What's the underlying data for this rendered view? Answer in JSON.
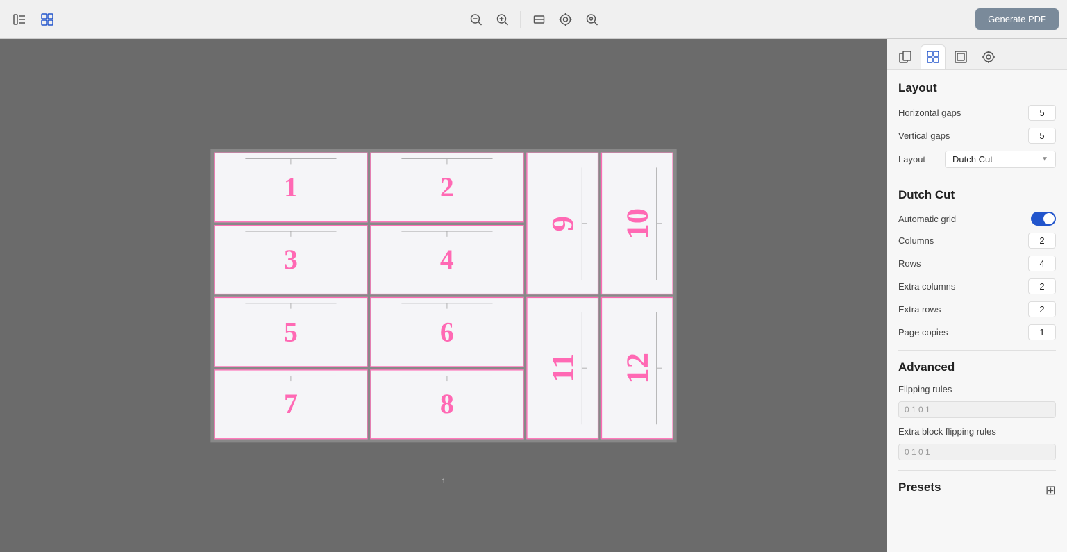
{
  "toolbar": {
    "zoom_out_label": "zoom-out",
    "zoom_in_label": "zoom-in",
    "fit_label": "fit",
    "zoom_reset_label": "zoom-reset",
    "zoom_full_label": "zoom-full",
    "generate_pdf": "Generate PDF"
  },
  "panel_tabs": [
    {
      "id": "copies",
      "icon": "⊞",
      "label": "Copies"
    },
    {
      "id": "layout",
      "icon": "▦",
      "label": "Layout",
      "active": true
    },
    {
      "id": "marks",
      "icon": "⊡",
      "label": "Marks"
    },
    {
      "id": "target",
      "icon": "◎",
      "label": "Target"
    }
  ],
  "layout_section": {
    "title": "Layout",
    "horizontal_gaps_label": "Horizontal gaps",
    "horizontal_gaps_value": "5",
    "vertical_gaps_label": "Vertical gaps",
    "vertical_gaps_value": "5",
    "layout_label": "Layout",
    "layout_value": "Dutch Cut"
  },
  "dutch_cut_section": {
    "title": "Dutch Cut",
    "automatic_grid_label": "Automatic grid",
    "columns_label": "Columns",
    "columns_value": "2",
    "rows_label": "Rows",
    "rows_value": "4",
    "extra_columns_label": "Extra columns",
    "extra_columns_value": "2",
    "extra_rows_label": "Extra rows",
    "extra_rows_value": "2",
    "page_copies_label": "Page copies",
    "page_copies_value": "1"
  },
  "advanced_section": {
    "title": "Advanced",
    "flipping_rules_label": "Flipping rules",
    "flipping_rules_value": "0 1 0 1",
    "extra_block_label": "Extra block flipping rules",
    "extra_block_value": "0 1 0 1"
  },
  "presets_section": {
    "title": "Presets"
  },
  "grid_cells": [
    {
      "num": "1",
      "type": "h"
    },
    {
      "num": "2",
      "type": "h"
    },
    {
      "num": "9",
      "type": "v"
    },
    {
      "num": "10",
      "type": "v"
    },
    {
      "num": "3",
      "type": "h"
    },
    {
      "num": "4",
      "type": "h"
    },
    {
      "num": "5",
      "type": "h"
    },
    {
      "num": "6",
      "type": "h"
    },
    {
      "num": "11",
      "type": "v"
    },
    {
      "num": "12",
      "type": "v"
    },
    {
      "num": "7",
      "type": "h"
    },
    {
      "num": "8",
      "type": "h"
    }
  ],
  "page_number": "1"
}
